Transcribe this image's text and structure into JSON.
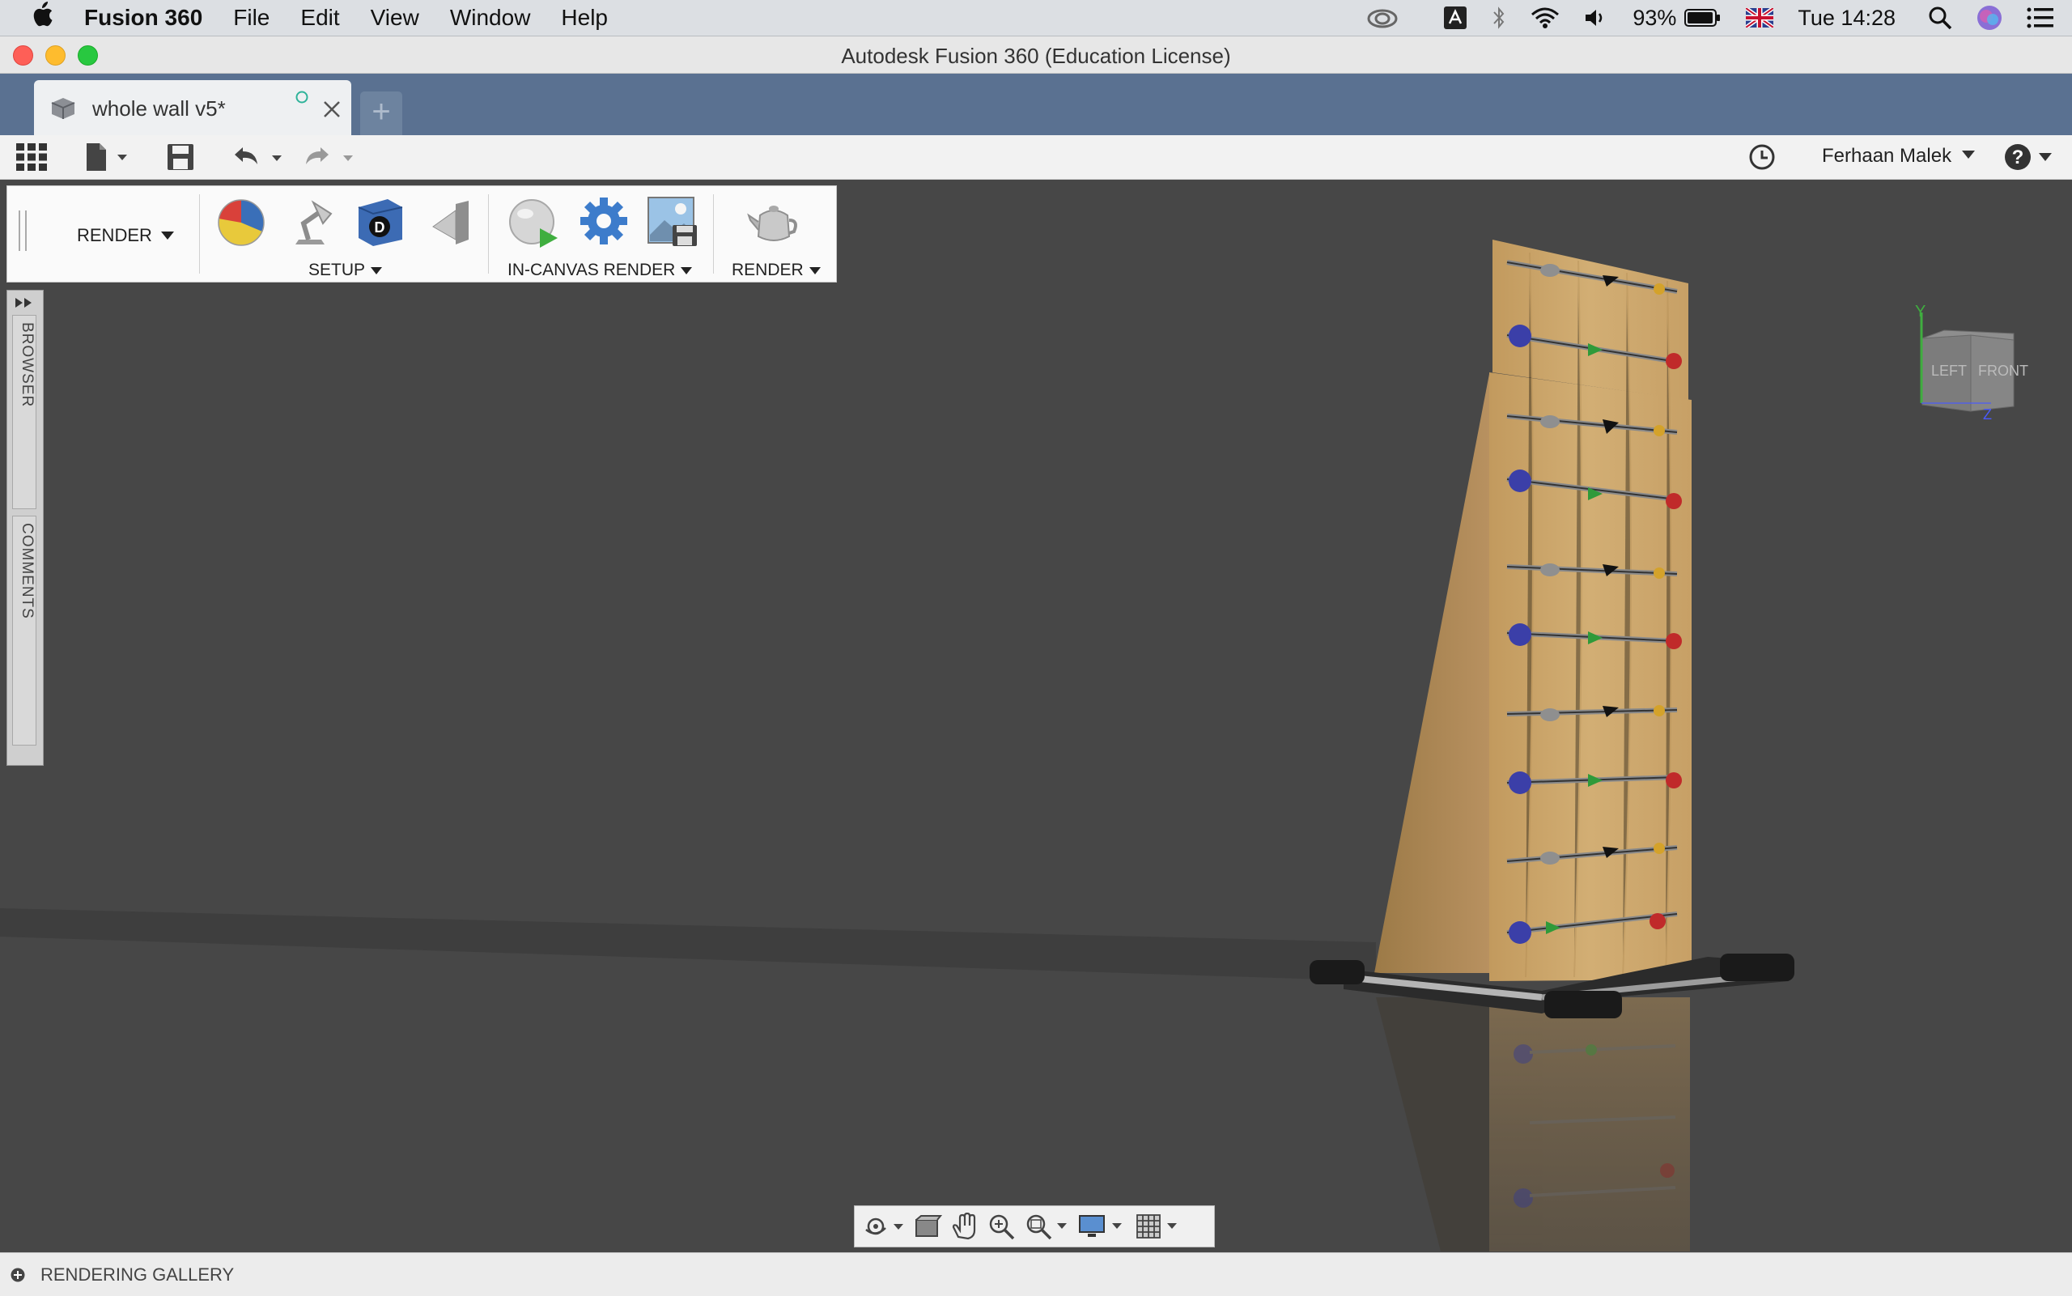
{
  "menubar": {
    "app_name": "Fusion 360",
    "items": [
      "File",
      "Edit",
      "View",
      "Window",
      "Help"
    ],
    "battery": "93%",
    "clock": "Tue 14:28"
  },
  "window": {
    "title": "Autodesk Fusion 360 (Education License)"
  },
  "document_tab": {
    "name": "whole wall v5*"
  },
  "toolbar": {
    "user_name": "Ferhaan Malek"
  },
  "ribbon": {
    "workspace": "RENDER",
    "groups": {
      "setup": "SETUP",
      "in_canvas": "IN-CANVAS RENDER",
      "render": "RENDER"
    }
  },
  "side_panel": {
    "browser": "BROWSER",
    "comments": "COMMENTS"
  },
  "viewcube": {
    "left_face": "LEFT",
    "front_face": "FRONT",
    "axis_y": "Y",
    "axis_z": "Z"
  },
  "bottom_bar": {
    "label": "RENDERING GALLERY"
  },
  "colors": {
    "tab_strip": "#5a7191",
    "canvas": "#474747",
    "wood": "#c9a56b"
  }
}
